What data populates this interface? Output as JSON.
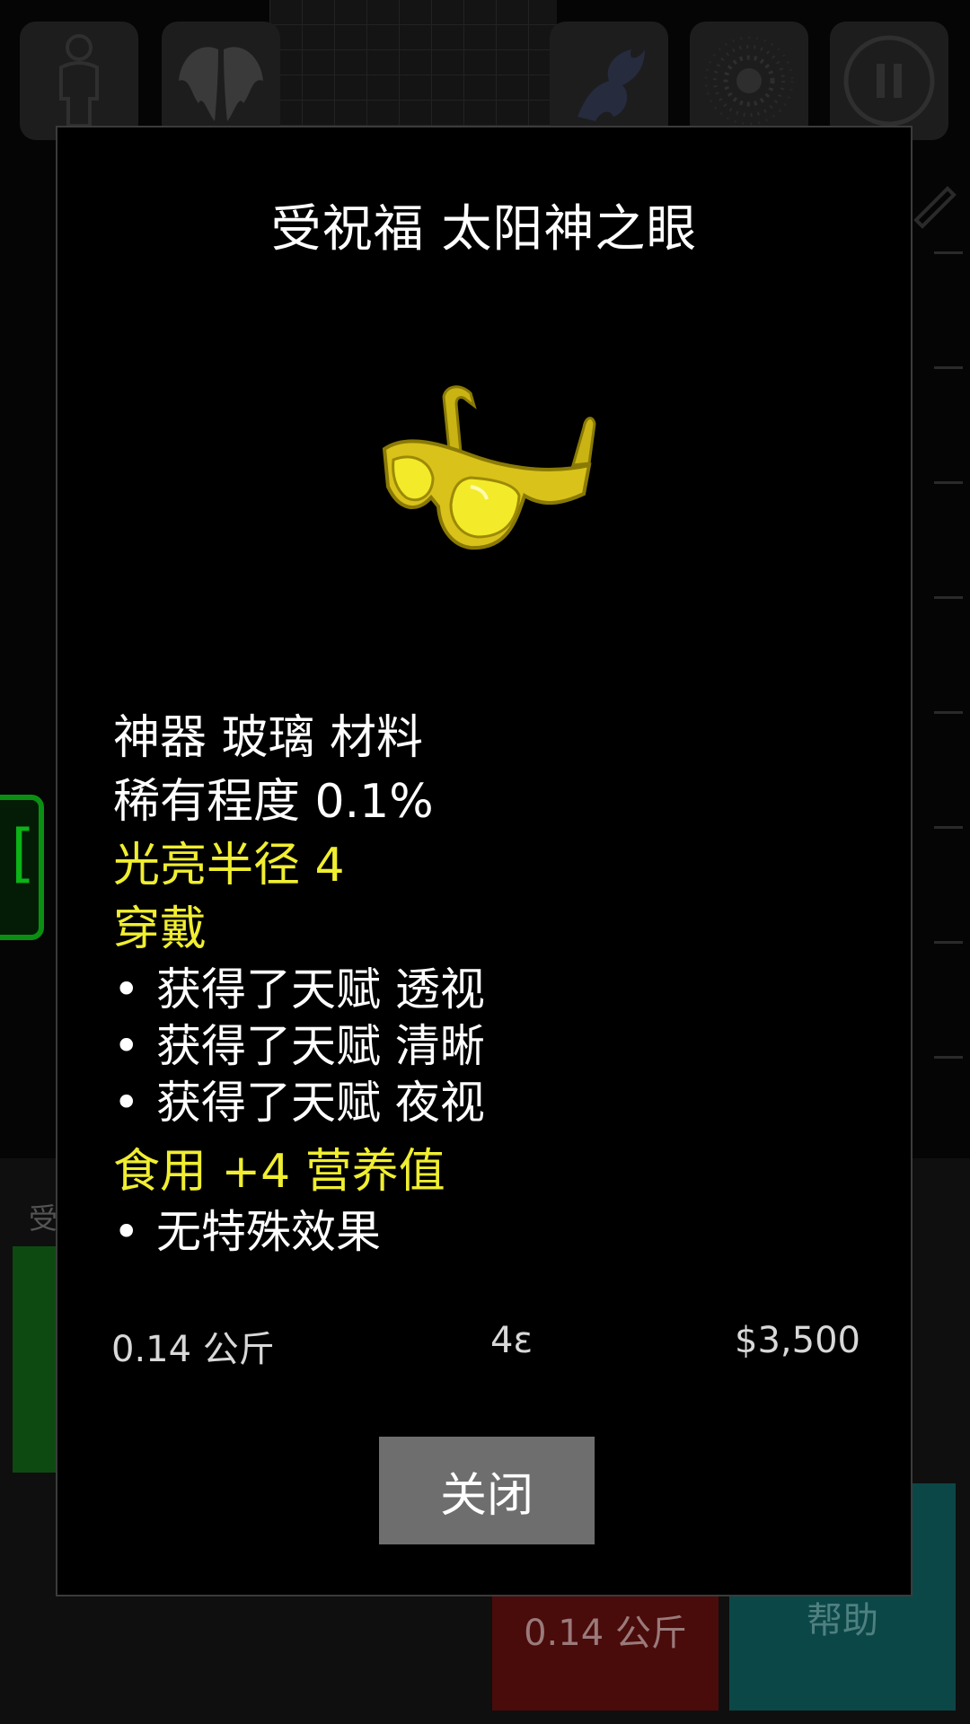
{
  "background": {
    "bottom_label": "受",
    "weight_tile": "0.14 公斤",
    "help_tile": "帮助"
  },
  "dialog": {
    "title": "受祝福 太阳神之眼",
    "item_icon": "sunglasses-icon",
    "lines": {
      "category": "神器 玻璃 材料",
      "rarity": "稀有程度 0.1%",
      "light_radius": "光亮半径 4",
      "wear_header": "穿戴",
      "wear_effects": [
        "获得了天赋 透视",
        "获得了天赋 清晰",
        "获得了天赋 夜视"
      ],
      "eat_header": "食用 +4 营养值",
      "eat_effects": [
        "无特殊效果"
      ]
    },
    "bullet": "•",
    "weight": "0.14 公斤",
    "size": "4ε",
    "price": "$3,500",
    "close_label": "关闭"
  },
  "colors": {
    "highlight": "#f0ee30",
    "close_button": "#6e6e6e",
    "item_gold": "#d9c21a"
  }
}
